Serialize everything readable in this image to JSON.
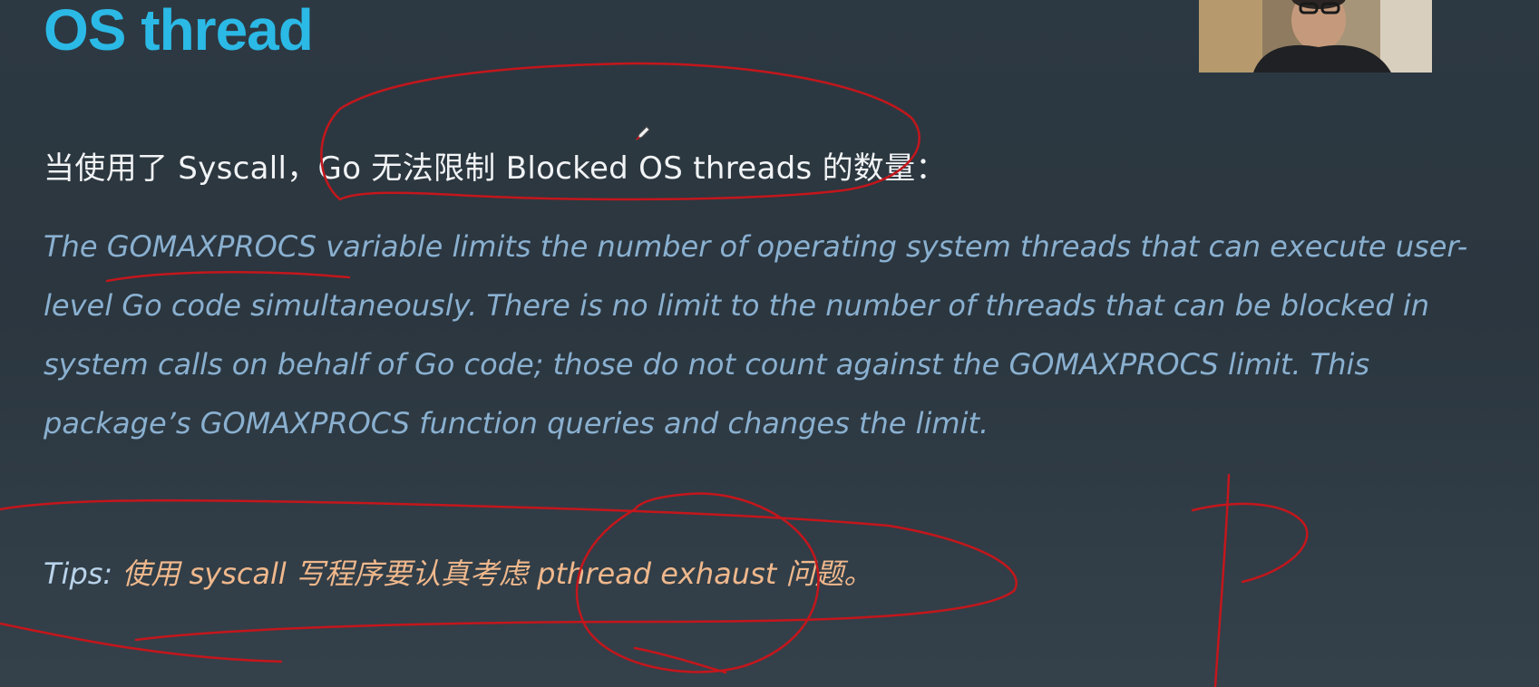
{
  "slide": {
    "title": "OS thread",
    "heading": "当使用了 Syscall，Go 无法限制 Blocked OS threads 的数量：",
    "quote_lines": [
      "The GOMAXPROCS variable limits the number of operating system threads that can execute user-",
      "level Go code simultaneously. There is no limit to the number of threads that can be blocked in",
      "system calls on behalf of Go code; those do not count against the GOMAXPROCS limit. This",
      "package’s GOMAXPROCS function queries and changes the limit."
    ],
    "tips": {
      "label": "Tips: ",
      "text": "使用 syscall 写程序要认真考虑 pthread exhaust 问题。"
    }
  },
  "colors": {
    "background": "#2d3942",
    "title": "#2bb9e6",
    "heading": "#f1f3f5",
    "quote": "#8ab0d0",
    "tips_label": "#b9d3ea",
    "tips_text": "#f0b88c",
    "annotation_ink": "#c4161c"
  },
  "overlays": {
    "webcam_icon": "presenter-webcam",
    "cursor_icon": "pen-cursor-icon"
  }
}
